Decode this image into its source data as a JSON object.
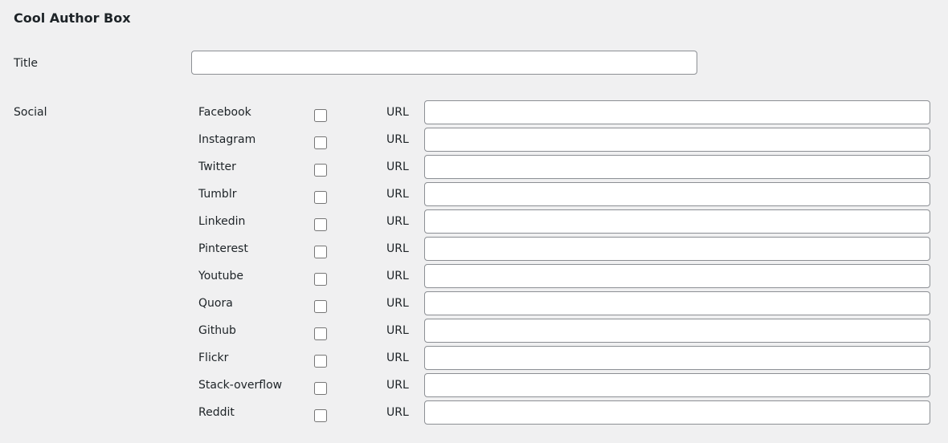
{
  "section": {
    "title": "Cool Author Box"
  },
  "title_field": {
    "label": "Title",
    "value": ""
  },
  "social": {
    "label": "Social",
    "url_label": "URL",
    "networks": [
      {
        "name": "Facebook",
        "checked": false,
        "url": ""
      },
      {
        "name": "Instagram",
        "checked": false,
        "url": ""
      },
      {
        "name": "Twitter",
        "checked": false,
        "url": ""
      },
      {
        "name": "Tumblr",
        "checked": false,
        "url": ""
      },
      {
        "name": "Linkedin",
        "checked": false,
        "url": ""
      },
      {
        "name": "Pinterest",
        "checked": false,
        "url": ""
      },
      {
        "name": "Youtube",
        "checked": false,
        "url": ""
      },
      {
        "name": "Quora",
        "checked": false,
        "url": ""
      },
      {
        "name": "Github",
        "checked": false,
        "url": ""
      },
      {
        "name": "Flickr",
        "checked": false,
        "url": ""
      },
      {
        "name": "Stack-overflow",
        "checked": false,
        "url": ""
      },
      {
        "name": "Reddit",
        "checked": false,
        "url": ""
      }
    ]
  }
}
